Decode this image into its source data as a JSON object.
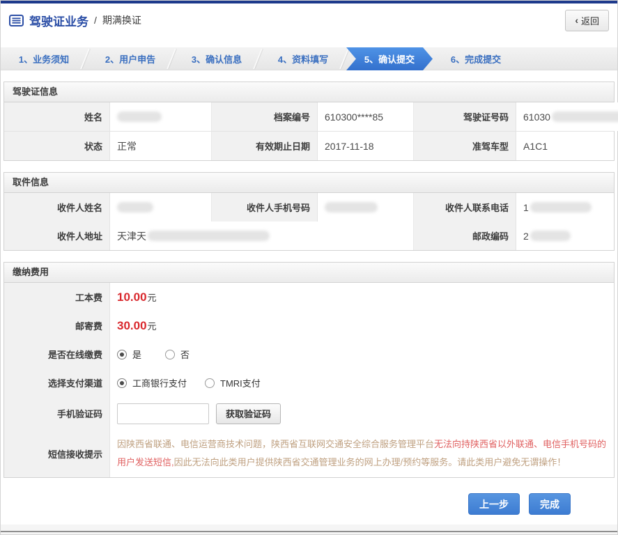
{
  "header": {
    "title": "驾驶证业务",
    "separator": "/",
    "subtitle": "期满换证",
    "back_icon": "‹",
    "back_label": "返回"
  },
  "steps": [
    {
      "label": "1、业务须知"
    },
    {
      "label": "2、用户申告"
    },
    {
      "label": "3、确认信息"
    },
    {
      "label": "4、资料填写"
    },
    {
      "label": "5、确认提交"
    },
    {
      "label": "6、完成提交"
    }
  ],
  "sections": {
    "license": {
      "title": "驾驶证信息",
      "fields": [
        {
          "label": "姓名",
          "value": ""
        },
        {
          "label": "档案编号",
          "value": "610300****85"
        },
        {
          "label": "驾驶证号码",
          "value": "61030"
        },
        {
          "label": "状态",
          "value": "正常"
        },
        {
          "label": "有效期止日期",
          "value": "2017-11-18"
        },
        {
          "label": "准驾车型",
          "value": "A1C1"
        }
      ]
    },
    "pickup": {
      "title": "取件信息",
      "fields": [
        {
          "label": "收件人姓名",
          "value": ""
        },
        {
          "label": "收件人手机号码",
          "value": ""
        },
        {
          "label": "收件人联系电话",
          "value": "1"
        },
        {
          "label": "收件人地址",
          "value": "天津天"
        },
        {
          "label": "邮政编码",
          "value": "2"
        }
      ]
    },
    "payment": {
      "title": "缴纳费用",
      "fees": [
        {
          "label": "工本费",
          "amount": "10.00",
          "unit": "元"
        },
        {
          "label": "邮寄费",
          "amount": "30.00",
          "unit": "元"
        }
      ],
      "online_payment": {
        "label": "是否在线缴费",
        "options": [
          {
            "text": "是",
            "selected": true
          },
          {
            "text": "否",
            "selected": false
          }
        ]
      },
      "channel": {
        "label": "选择支付渠道",
        "options": [
          {
            "text": "工商银行支付",
            "selected": true
          },
          {
            "text": "TMRI支付",
            "selected": false
          }
        ]
      },
      "sms_code": {
        "label": "手机验证码",
        "input_value": "",
        "button_label": "获取验证码"
      },
      "sms_notice": {
        "label": "短信接收提示",
        "part1": "因陕西省联通、电信运营商技术问题，陕西省互联网交通安全综合服务管理平台",
        "part2": "无法向持陕西省以外联通、电信手机号码的用户发送短信,",
        "part3": "因此无法向此类用户提供陕西省交通管理业务的网上办理/预约等服务。请此类用户避免无谓操作！"
      }
    }
  },
  "footer": {
    "prev_label": "上一步",
    "finish_label": "完成"
  },
  "colors": {
    "top_bar": "#1e3a8c",
    "title_blue": "#2b4ea6",
    "step_active_blue": "#3f7fd6",
    "fee_red": "#d9292e",
    "notice_tan": "#bfa080",
    "notice_red": "#e06060",
    "button_blue": "#4285d3"
  }
}
